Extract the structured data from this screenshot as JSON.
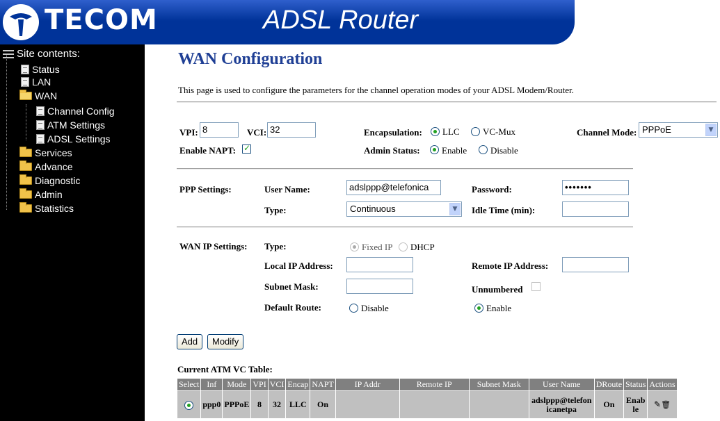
{
  "header": {
    "brand": "TECOM",
    "product": "ADSL Router"
  },
  "sidebar": {
    "root": "Site contents:",
    "items": [
      {
        "label": "Status",
        "type": "page"
      },
      {
        "label": "LAN",
        "type": "page"
      },
      {
        "label": "WAN",
        "type": "folder-open"
      },
      {
        "label": "Channel Config",
        "type": "page"
      },
      {
        "label": "ATM Settings",
        "type": "page"
      },
      {
        "label": "ADSL Settings",
        "type": "page"
      },
      {
        "label": "Services",
        "type": "folder"
      },
      {
        "label": "Advance",
        "type": "folder"
      },
      {
        "label": "Diagnostic",
        "type": "folder"
      },
      {
        "label": "Admin",
        "type": "folder"
      },
      {
        "label": "Statistics",
        "type": "folder"
      }
    ]
  },
  "main": {
    "title": "WAN Configuration",
    "intro": "This page is used to configure the parameters for the channel operation modes of your ADSL Modem/Router.",
    "vpi_label": "VPI:",
    "vpi_value": "8",
    "vci_label": "VCI:",
    "vci_value": "32",
    "encap_label": "Encapsulation:",
    "encap_llc": "LLC",
    "encap_vcmux": "VC-Mux",
    "channel_mode_label": "Channel Mode:",
    "channel_mode_value": "PPPoE",
    "napt_label": "Enable NAPT:",
    "admin_status_label": "Admin Status:",
    "admin_enable": "Enable",
    "admin_disable": "Disable",
    "ppp_settings_label": "PPP Settings:",
    "username_label": "User Name:",
    "username_value": "adslppp@telefonica",
    "password_label": "Password:",
    "password_value": "•••••••",
    "type_label": "Type:",
    "type_value": "Continuous",
    "idle_label": "Idle Time (min):",
    "idle_value": "",
    "wanip_label": "WAN IP Settings:",
    "wanip_type_label": "Type:",
    "fixed_ip": "Fixed IP",
    "dhcp": "DHCP",
    "local_ip_label": "Local IP Address:",
    "local_ip_value": "",
    "remote_ip_label": "Remote IP Address:",
    "remote_ip_value": "",
    "subnet_label": "Subnet Mask:",
    "subnet_value": "",
    "unnumbered_label": "Unnumbered",
    "default_route_label": "Default Route:",
    "route_disable": "Disable",
    "route_enable": "Enable",
    "add_button": "Add",
    "modify_button": "Modify",
    "table_title": "Current ATM VC Table:"
  },
  "table": {
    "headers": [
      "Select",
      "Inf",
      "Mode",
      "VPI",
      "VCI",
      "Encap",
      "NAPT",
      "IP Addr",
      "Remote IP",
      "Subnet Mask",
      "User Name",
      "DRoute",
      "Status",
      "Actions"
    ],
    "rows": [
      {
        "inf": "ppp0",
        "mode": "PPPoE",
        "vpi": "8",
        "vci": "32",
        "encap": "LLC",
        "napt": "On",
        "ip": "",
        "remote": "",
        "mask": "",
        "user": "adslppp@telefonicanetpa",
        "droute": "On",
        "status": "Enable"
      }
    ]
  },
  "colors": {
    "banner": "#003399",
    "title": "#1f3f95",
    "sidebar": "#000000",
    "table_header": "#808080",
    "table_cell": "#c0c0c0"
  }
}
